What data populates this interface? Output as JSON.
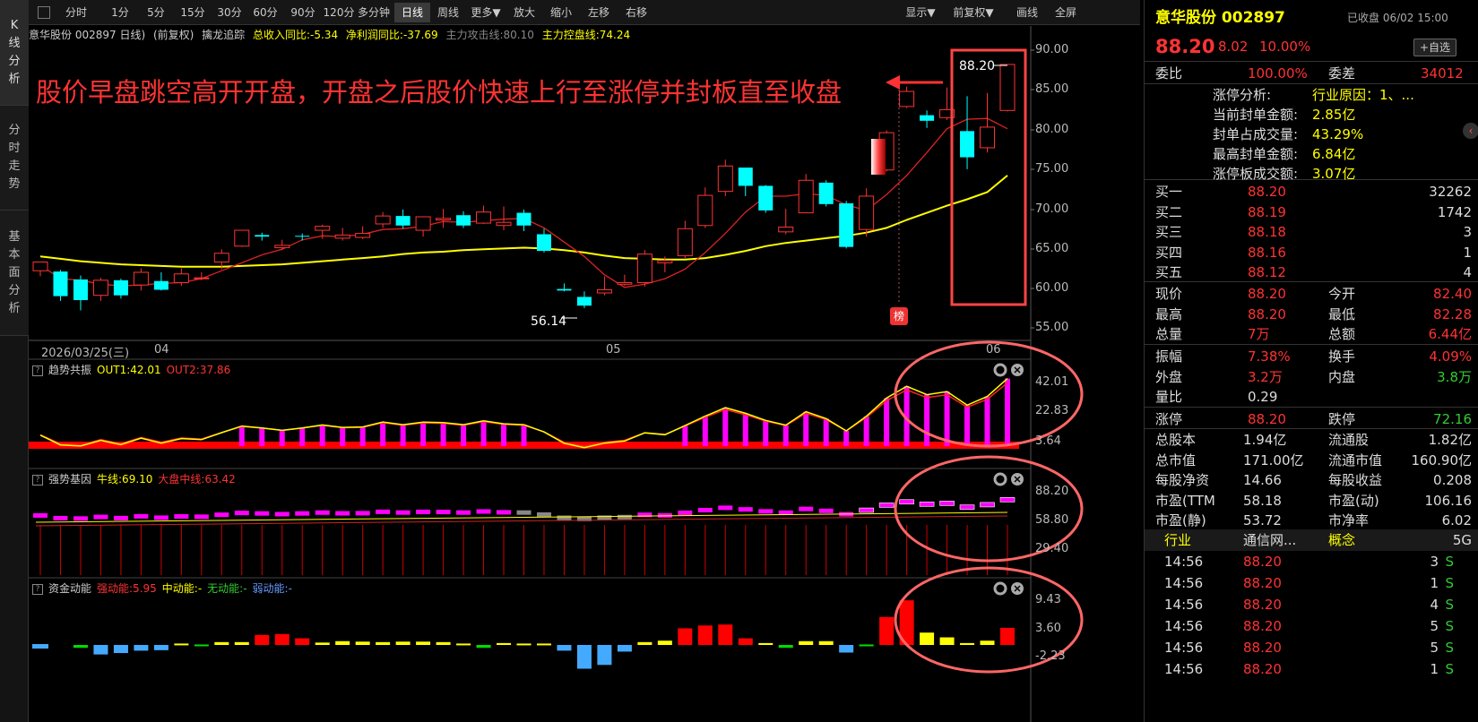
{
  "left_tabs": [
    [
      "K",
      "线",
      "分",
      "析"
    ],
    [
      "分",
      "时",
      "走",
      "势"
    ],
    [
      "基",
      "本",
      "面",
      "分",
      "析"
    ]
  ],
  "toolbar": {
    "buttons": [
      "分时",
      "1分",
      "5分",
      "15分",
      "30分",
      "60分",
      "90分",
      "120分",
      "多分钟",
      "日线",
      "周线",
      "更多▼",
      "放大",
      "缩小",
      "左移",
      "右移"
    ],
    "right_buttons": [
      "显示▼",
      "前复权▼",
      "画线",
      "全屏"
    ],
    "selected": "日线"
  },
  "info": {
    "name": "意华股份 002897 日线)",
    "fq": "(前复权)",
    "indicator": "擒龙追踪",
    "items": [
      "总收入同比:-5.34",
      "净利润同比:-37.69",
      "主力攻击线:80.10",
      "主力控盘线:74.24"
    ]
  },
  "main_chart": {
    "annotation": "股价早盘跳空高开开盘，开盘之后股价快速上行至涨停并封板直至收盘",
    "y_ticks": [
      "90.00",
      "85.00",
      "80.00",
      "75.00",
      "70.00",
      "65.00",
      "60.00",
      "55.00"
    ],
    "x_labels": [
      "2026/03/25(三)",
      "04",
      "05",
      "06"
    ],
    "high_label": "88.20",
    "low_label": "56.14",
    "badge": "榜"
  },
  "sub1": {
    "title": "趋势共振",
    "out1": "OUT1:42.01",
    "out2": "OUT2:37.86",
    "ticks": [
      "42.01",
      "22.83",
      "3.64"
    ]
  },
  "sub2": {
    "title": "强势基因",
    "bull": "牛线:69.10",
    "mid": "大盘中线:63.42",
    "ticks": [
      "88.20",
      "58.80",
      "29.40"
    ]
  },
  "sub3": {
    "title": "资金动能",
    "strong": "强动能:5.95",
    "middle": "中动能:-",
    "none": "无动能:-",
    "weak": "弱动能:-",
    "ticks": [
      "9.43",
      "3.60",
      "-2.23"
    ]
  },
  "quote": {
    "name": "意华股份 002897",
    "status": "已收盘 06/02 15:00",
    "price": "88.20",
    "change": "8.02",
    "pct": "10.00%",
    "watch": "+自选",
    "weibi_label": "委比",
    "weibi": "100.00%",
    "weicha_label": "委差",
    "weicha": "34012",
    "limit_info": [
      [
        "涨停分析:",
        "行业原因：1、..."
      ],
      [
        "当前封单金额:",
        "2.85亿"
      ],
      [
        "封单占成交量:",
        "43.29%"
      ],
      [
        "最高封单金额:",
        "6.84亿"
      ],
      [
        "涨停板成交额:",
        "3.07亿"
      ]
    ],
    "bids": [
      [
        "买一",
        "88.20",
        "32262"
      ],
      [
        "买二",
        "88.19",
        "1742"
      ],
      [
        "买三",
        "88.18",
        "3"
      ],
      [
        "买四",
        "88.16",
        "1"
      ],
      [
        "买五",
        "88.12",
        "4"
      ]
    ],
    "stats": [
      [
        "现价",
        "88.20",
        "今开",
        "82.40"
      ],
      [
        "最高",
        "88.20",
        "最低",
        "82.28"
      ],
      [
        "总量",
        "7万",
        "总额",
        "6.44亿"
      ]
    ],
    "stats2": [
      [
        "振幅",
        "7.38%",
        "换手",
        "4.09%"
      ],
      [
        "外盘",
        "3.2万",
        "内盘",
        "3.8万"
      ],
      [
        "量比",
        "0.29",
        "",
        ""
      ]
    ],
    "limits": [
      [
        "涨停",
        "88.20",
        "跌停",
        "72.16"
      ]
    ],
    "fund": [
      [
        "总股本",
        "1.94亿",
        "流通股",
        "1.82亿"
      ],
      [
        "总市值",
        "171.00亿",
        "流通市值",
        "160.90亿"
      ],
      [
        "每股净资",
        "14.66",
        "每股收益",
        "0.208"
      ],
      [
        "市盈(TTM",
        "58.18",
        "市盈(动)",
        "106.16"
      ],
      [
        "市盈(静)",
        "53.72",
        "市净率",
        "6.02"
      ]
    ],
    "sector": [
      "行业",
      "通信网...",
      "概念",
      "5G"
    ],
    "ticks": [
      [
        "14:56",
        "88.20",
        "3",
        "S"
      ],
      [
        "14:56",
        "88.20",
        "1",
        "S"
      ],
      [
        "14:56",
        "88.20",
        "4",
        "S"
      ],
      [
        "14:56",
        "88.20",
        "5",
        "S"
      ],
      [
        "14:56",
        "88.20",
        "5",
        "S"
      ],
      [
        "14:56",
        "88.20",
        "1",
        "S"
      ]
    ]
  },
  "chart_data": {
    "type": "candlestick",
    "y_range": [
      53,
      92
    ],
    "candles": [
      [
        62.2,
        63.3,
        61.5,
        62.9
      ],
      [
        62.1,
        59,
        58.4,
        62.3
      ],
      [
        61.1,
        58.5,
        57.2,
        61.6
      ],
      [
        59.1,
        61,
        58.4,
        61.3
      ],
      [
        61,
        59.1,
        58.7,
        61.2
      ],
      [
        60.4,
        62,
        59.7,
        62.5
      ],
      [
        60.9,
        59.8,
        59.7,
        62
      ],
      [
        60.7,
        61.8,
        60.3,
        62.5
      ],
      [
        61.2,
        61.3,
        61,
        62
      ],
      [
        63.3,
        64.4,
        62.4,
        64.9
      ],
      [
        65.3,
        67.3,
        65.2,
        67.3
      ],
      [
        66.7,
        66.5,
        66,
        67
      ],
      [
        65.1,
        65.4,
        64.8,
        66.1
      ],
      [
        66.6,
        66.5,
        66,
        66.9
      ],
      [
        67.3,
        67.8,
        66.2,
        68
      ],
      [
        66.3,
        66.7,
        66,
        67.6
      ],
      [
        66.4,
        66.9,
        66.2,
        67.8
      ],
      [
        68.1,
        69.1,
        67.6,
        69.6
      ],
      [
        69.1,
        67.9,
        67.5,
        69.9
      ],
      [
        67.3,
        69,
        66.5,
        69
      ],
      [
        68.6,
        68.8,
        67.6,
        70
      ],
      [
        69.2,
        67.9,
        67.6,
        69.7
      ],
      [
        68.2,
        69.6,
        68.1,
        70.4
      ],
      [
        67.9,
        68.3,
        67.3,
        70.3
      ],
      [
        69.5,
        67.9,
        67.2,
        69.9
      ],
      [
        66.8,
        64.7,
        64.5,
        67.5
      ],
      [
        59.9,
        59.7,
        59.6,
        60.6
      ],
      [
        58.9,
        57.8,
        57.5,
        59.6
      ],
      [
        59.4,
        59.8,
        59.1,
        61.5
      ],
      [
        60.5,
        60.7,
        60.3,
        61.7
      ],
      [
        60.7,
        64.3,
        60.2,
        64.8
      ],
      [
        63.2,
        63.5,
        62,
        64
      ],
      [
        64.1,
        67.5,
        63.8,
        68.5
      ],
      [
        67.9,
        71.7,
        67.6,
        72.7
      ],
      [
        72.2,
        75.4,
        71.6,
        76.2
      ],
      [
        75.2,
        72.9,
        71.6,
        74.9
      ],
      [
        72.9,
        69.8,
        69.5,
        73
      ],
      [
        67.1,
        67.7,
        66.8,
        70
      ],
      [
        69.5,
        73.6,
        69.5,
        74.4
      ],
      [
        73.3,
        70.6,
        70.3,
        73.6
      ],
      [
        70.7,
        65.2,
        65,
        71
      ],
      [
        67.4,
        71.6,
        66.5,
        72.6
      ],
      [
        74.9,
        79.6,
        74.7,
        79.9
      ],
      [
        82.9,
        84.8,
        82.7,
        85.4
      ],
      [
        81.8,
        81.1,
        80.2,
        82.4
      ],
      [
        81.5,
        82.5,
        81.2,
        85.3
      ],
      [
        79.8,
        76.5,
        75,
        84.2
      ],
      [
        77.7,
        80.3,
        77.1,
        84.6
      ],
      [
        82.4,
        88.2,
        82.28,
        88.2
      ]
    ],
    "ma5": [
      62.9,
      61.2,
      61,
      60.5,
      60.3,
      60.4,
      60.6,
      60.7,
      61.2,
      62.2,
      63.2,
      64.2,
      64.9,
      66.1,
      66.6,
      66.5,
      66.8,
      67.4,
      67.5,
      67.8,
      68.4,
      68.3,
      68.5,
      68.7,
      68.8,
      67.6,
      65.8,
      64,
      61.7,
      60.1,
      60.5,
      61.2,
      62.4,
      64.5,
      66.9,
      69.6,
      71.6,
      71.6,
      71.9,
      71.7,
      70.5,
      69.8,
      71.8,
      74.2,
      77.1,
      80.1,
      81.3,
      81.4,
      80.1
    ],
    "ma20": [
      64,
      63.7,
      63.4,
      63.2,
      63,
      62.9,
      62.8,
      62.7,
      62.7,
      62.7,
      62.8,
      62.9,
      63,
      63.2,
      63.4,
      63.6,
      63.8,
      64,
      64.3,
      64.5,
      64.6,
      64.8,
      64.9,
      65,
      65.1,
      65,
      64.8,
      64.5,
      64.1,
      63.8,
      63.7,
      63.6,
      63.6,
      63.8,
      64.2,
      64.7,
      65.3,
      65.7,
      66,
      66.3,
      66.6,
      67,
      67.6,
      68.6,
      69.5,
      70.4,
      71.2,
      72.1,
      74.2
    ]
  }
}
